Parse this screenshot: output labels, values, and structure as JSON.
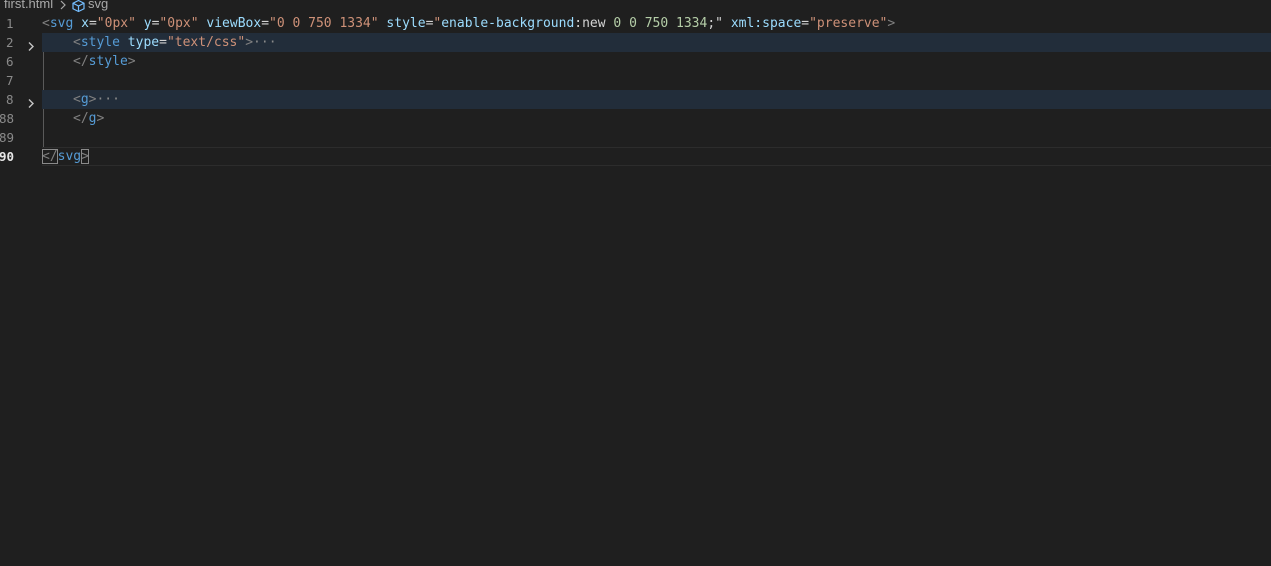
{
  "breadcrumb": {
    "file": "first.html",
    "separator_icon": "chevron-right-icon",
    "symbol_icon": "cube-icon",
    "symbol": "svg"
  },
  "editor": {
    "lines": [
      {
        "number": "1"
      },
      {
        "number": "2",
        "folded": true
      },
      {
        "number": "6"
      },
      {
        "number": "7"
      },
      {
        "number": "8",
        "folded": true
      },
      {
        "number": "88"
      },
      {
        "number": "89"
      },
      {
        "number": "90",
        "active": true
      }
    ],
    "code": {
      "l1": {
        "open": "<",
        "tag": "svg",
        "a1": "x",
        "eq": "=",
        "v1": "\"0px\"",
        "a2": "y",
        "v2": "\"0px\"",
        "a3": "viewBox",
        "v3": "\"0 0 750 1334\"",
        "a4": "style",
        "v4_q1": "\"",
        "v4_prop": "enable-background",
        "v4_colon": ":",
        "v4_kw": "new",
        "v4_nums": " 0 0 750 1334",
        "v4_end": ";\"",
        "a5": "xml:space",
        "v5": "\"preserve\"",
        "close": ">"
      },
      "l2": {
        "open": "<",
        "tag": "style",
        "attr": "type",
        "eq": "=",
        "value": "\"text/css\"",
        "close": ">",
        "ellipsis": "···"
      },
      "l6": {
        "open": "</",
        "tag": "style",
        "close": ">"
      },
      "l8": {
        "open": "<",
        "tag": "g",
        "close": ">",
        "ellipsis": "···"
      },
      "l88": {
        "open": "</",
        "tag": "g",
        "close": ">"
      },
      "l90": {
        "open": "</",
        "tag": "svg",
        "close": ">"
      }
    }
  },
  "colors": {
    "background": "#1f1f1f",
    "tag": "#569cd6",
    "attribute": "#9cdcfe",
    "string": "#ce9178",
    "number": "#b5cea8",
    "fold_highlight": "#222d3a"
  }
}
